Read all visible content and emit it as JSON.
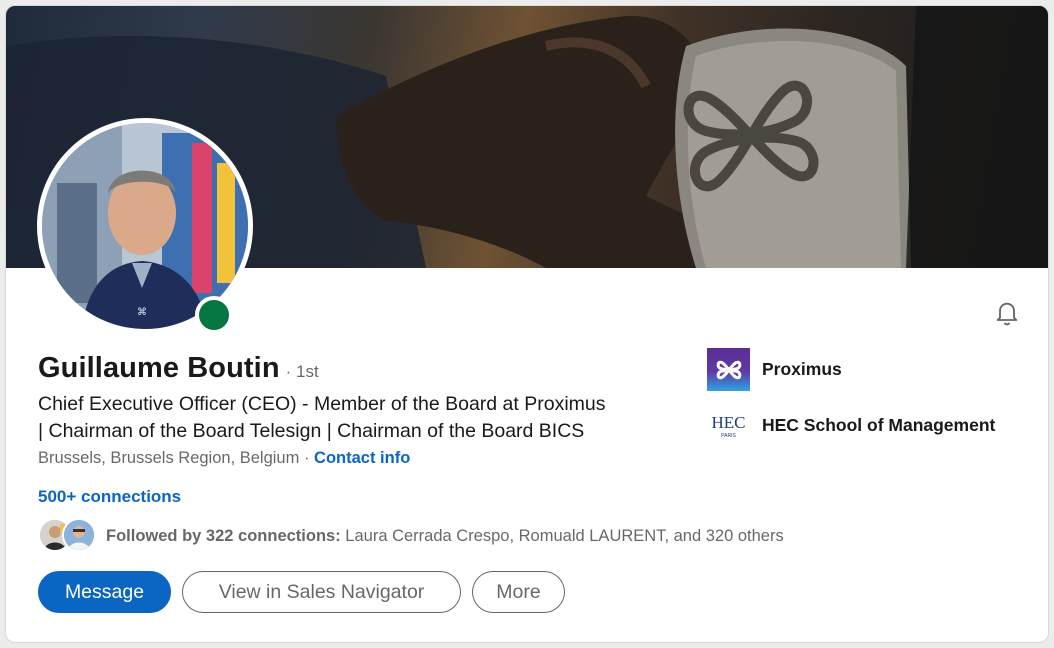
{
  "profile": {
    "name": "Guillaume Boutin",
    "degree": "· 1st",
    "headline_line1": "Chief Executive Officer (CEO) - Member of the Board at Proximus",
    "headline_line2": "| Chairman of the Board Telesign | Chairman of the Board BICS",
    "location": "Brussels, Brussels Region, Belgium",
    "location_separator": " · ",
    "contact_info_label": "Contact info",
    "connections_label": "500+ connections",
    "online_status_color": "#057642"
  },
  "followed_by": {
    "count_label": "Followed by 322 connections:",
    "names": " Laura Cerrada Crespo, Romuald LAURENT, and 320 others"
  },
  "actions": {
    "message_label": "Message",
    "sales_navigator_label": "View in Sales Navigator",
    "more_label": "More"
  },
  "organizations": [
    {
      "name": "Proximus",
      "logo_icon": "proximus-logo"
    },
    {
      "name": "HEC School of Management",
      "logo_icon": "hec-logo",
      "logo_text": "HEC",
      "logo_subtext": "PARIS"
    }
  ],
  "icons": {
    "notifications": "bell-icon"
  },
  "colors": {
    "accent": "#0a66c2",
    "proximus_purple": "#5b2d91"
  }
}
